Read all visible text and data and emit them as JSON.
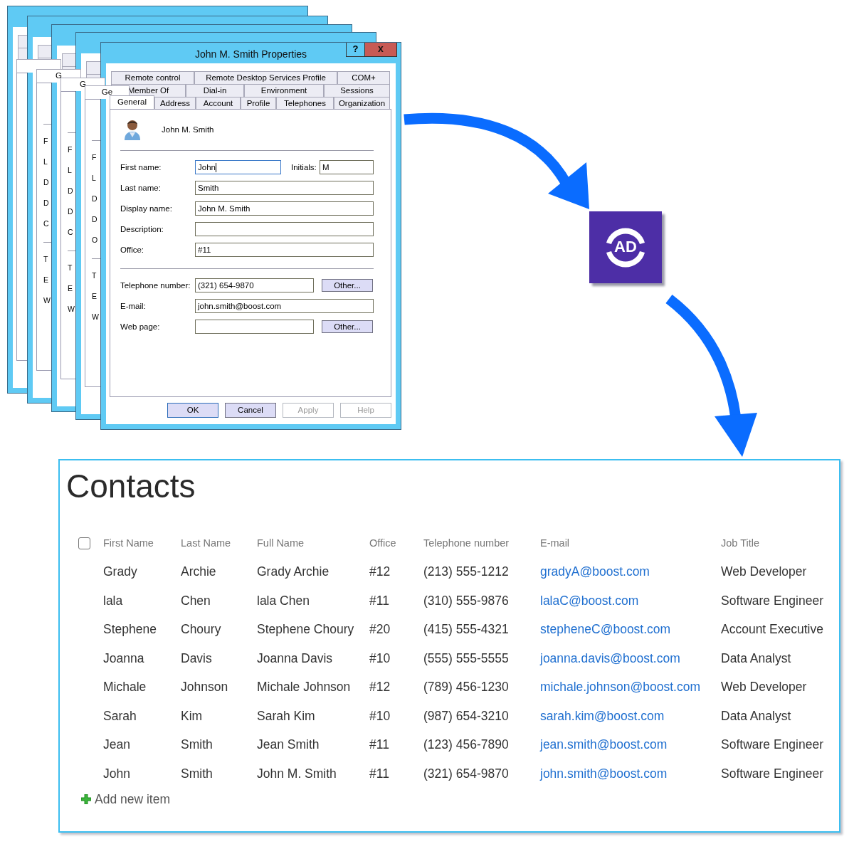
{
  "background_windows": [
    {
      "kind": "window"
    },
    {
      "kind": "window",
      "tab_fragment": "G",
      "field_fragments": [
        [
          "F",
          "L",
          "D",
          "D",
          "C"
        ],
        [
          "T",
          "E",
          "W"
        ]
      ]
    },
    {
      "kind": "window",
      "tab_fragment": "G",
      "field_fragments": [
        [
          "F",
          "L",
          "D",
          "D",
          "C"
        ],
        [
          "T",
          "E",
          "W"
        ]
      ]
    },
    {
      "kind": "window",
      "tab_fragment": "Ge",
      "field_fragments": [
        [
          "F",
          "L",
          "D",
          "D",
          "O"
        ],
        [
          "T",
          "E",
          "W"
        ]
      ]
    }
  ],
  "dialog": {
    "title": "John M. Smith Properties",
    "help_button": "?",
    "close_button": "x",
    "tab_rows": [
      [
        {
          "label": "Remote control",
          "selected": false
        },
        {
          "label": "Remote Desktop Services Profile",
          "selected": false
        },
        {
          "label": "COM+",
          "selected": false
        }
      ],
      [
        {
          "label": "Member Of",
          "selected": false
        },
        {
          "label": "Dial-in",
          "selected": false
        },
        {
          "label": "Environment",
          "selected": false
        },
        {
          "label": "Sessions",
          "selected": false
        }
      ],
      [
        {
          "label": "General",
          "selected": true
        },
        {
          "label": "Address",
          "selected": false
        },
        {
          "label": "Account",
          "selected": false
        },
        {
          "label": "Profile",
          "selected": false
        },
        {
          "label": "Telephones",
          "selected": false
        },
        {
          "label": "Organization",
          "selected": false
        }
      ]
    ],
    "user_name": "John M. Smith",
    "sections": [
      [
        {
          "kind": "pair",
          "label": "First name:",
          "value": "John",
          "focused": true,
          "label_2": "Initials:",
          "value_2": "M"
        },
        {
          "kind": "text",
          "label": "Last name:",
          "value": "Smith",
          "focused": false
        },
        {
          "kind": "text",
          "label": "Display name:",
          "value": "John M. Smith",
          "focused": false
        },
        {
          "kind": "text",
          "label": "Description:",
          "focused": false
        },
        {
          "kind": "text",
          "label": "Office:",
          "value": "#11",
          "focused": false
        }
      ],
      [
        {
          "kind": "button",
          "label": "Telephone number:",
          "value": "(321) 654-9870",
          "button": "Other...",
          "focused": false
        },
        {
          "kind": "text",
          "label": "E-mail:",
          "value": "john.smith@boost.com",
          "focused": false
        },
        {
          "kind": "button",
          "label": "Web page:",
          "button": "Other...",
          "focused": false
        }
      ]
    ],
    "buttons": [
      {
        "label": "OK",
        "disabled": false,
        "default": true
      },
      {
        "label": "Cancel",
        "disabled": false,
        "default": false
      },
      {
        "label": "Apply",
        "disabled": true,
        "default": false
      },
      {
        "label": "Help",
        "disabled": true,
        "default": false
      }
    ]
  },
  "logo": {
    "text": "AD"
  },
  "contacts": {
    "title": "Contacts",
    "select_all": {
      "checked": false
    },
    "columns": [
      {
        "label": "First Name",
        "kind": "text"
      },
      {
        "label": "Last Name",
        "kind": "text"
      },
      {
        "label": "Full Name",
        "kind": "text"
      },
      {
        "label": "Office",
        "kind": "text"
      },
      {
        "label": "Telephone number",
        "kind": "text"
      },
      {
        "label": "E-mail",
        "kind": "link"
      },
      {
        "label": "Job Title",
        "kind": "text"
      }
    ],
    "rows": [
      [
        "Grady",
        "Archie",
        "Grady Archie",
        "#12",
        "(213) 555-1212",
        "gradyA@boost.com",
        "Web Developer"
      ],
      [
        "lala",
        "Chen",
        "lala Chen",
        "#11",
        "(310) 555-9876",
        "lalaC@boost.com",
        "Software Engineer"
      ],
      [
        "Stephene",
        "Choury",
        "Stephene Choury",
        "#20",
        "(415) 555-4321",
        "stepheneC@boost.com",
        "Account Executive"
      ],
      [
        "Joanna",
        "Davis",
        "Joanna Davis",
        "#10",
        "(555) 555-5555",
        "joanna.davis@boost.com",
        "Data Analyst"
      ],
      [
        "Michale",
        "Johnson",
        "Michale Johnson",
        "#12",
        "(789) 456-1230",
        "michale.johnson@boost.com",
        "Web Developer"
      ],
      [
        "Sarah",
        "Kim",
        "Sarah Kim",
        "#10",
        "(987) 654-3210",
        "sarah.kim@boost.com",
        "Data Analyst"
      ],
      [
        "Jean",
        "Smith",
        "Jean Smith",
        "#11",
        "(123) 456-7890",
        "jean.smith@boost.com",
        "Software Engineer"
      ],
      [
        "John",
        "Smith",
        "John M. Smith",
        "#11",
        "(321) 654-9870",
        "john.smith@boost.com",
        "Software Engineer"
      ]
    ],
    "add_item": "Add new item"
  }
}
